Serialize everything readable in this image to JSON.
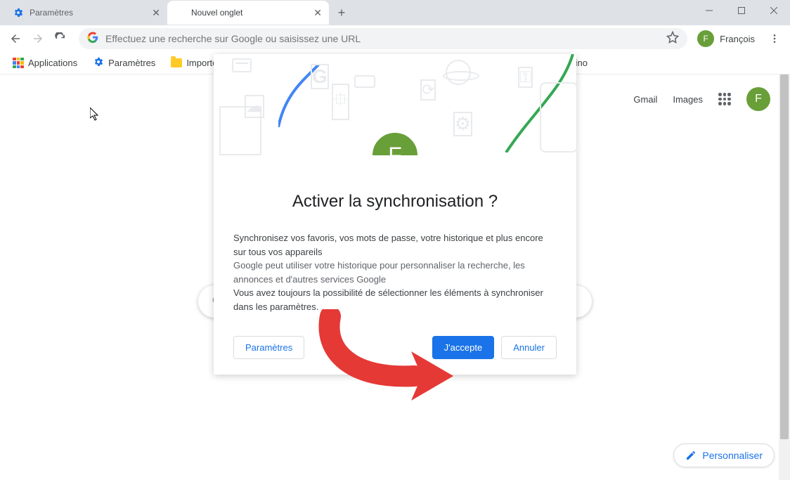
{
  "window": {
    "minimize": "–",
    "maximize": "□",
    "close": "✕"
  },
  "tabs": [
    {
      "title": "Paramètres",
      "active": false
    },
    {
      "title": "Nouvel onglet",
      "active": true
    }
  ],
  "toolbar": {
    "omnibox_placeholder": "Effectuez une recherche sur Google ou saisissez une URL",
    "profile_name": "François",
    "profile_initial": "F"
  },
  "bookmarks": [
    {
      "type": "apps",
      "label": "Applications"
    },
    {
      "type": "gear",
      "label": "Paramètres"
    },
    {
      "type": "folder",
      "label": "Importés de"
    },
    {
      "type": "folder",
      "label": "Pi/Arduino"
    }
  ],
  "ntp": {
    "gmail": "Gmail",
    "images": "Images",
    "avatar_initial": "F",
    "customize": "Personnaliser"
  },
  "dialog": {
    "avatar_initial": "F",
    "title": "Activer la synchronisation ?",
    "line1": "Synchronisez vos favoris, vos mots de passe, votre historique et plus encore sur tous vos appareils",
    "line2": "Google peut utiliser votre historique pour personnaliser la recherche, les annonces et d'autres services Google",
    "line3": "Vous avez toujours la possibilité de sélectionner les éléments à synchroniser dans les paramètres.",
    "settings_btn": "Paramètres",
    "accept_btn": "J'accepte",
    "cancel_btn": "Annuler"
  }
}
